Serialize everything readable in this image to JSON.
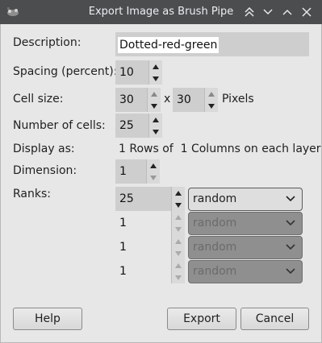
{
  "window": {
    "title": "Export Image as Brush Pipe"
  },
  "titlebar_icons": [
    "app-icon",
    "keep-above-icon",
    "minimize-icon",
    "maximize-icon",
    "close-icon"
  ],
  "fields": {
    "description": {
      "label": "Description:",
      "value": "Dotted-red-green"
    },
    "spacing": {
      "label": "Spacing (percent):",
      "value": "10"
    },
    "cell_size": {
      "label": "Cell size:",
      "width": "30",
      "separator": "x",
      "height": "30",
      "unit": "Pixels"
    },
    "num_cells": {
      "label": "Number of cells:",
      "value": "25"
    },
    "display_as": {
      "label": "Display as:",
      "value": "1 Rows of  1 Columns on each layer"
    },
    "dimension": {
      "label": "Dimension:",
      "value": "1"
    },
    "ranks": {
      "label": "Ranks:",
      "rows": [
        {
          "value": "25",
          "selection": "random",
          "enabled": true
        },
        {
          "value": "1",
          "selection": "random",
          "enabled": false
        },
        {
          "value": "1",
          "selection": "random",
          "enabled": false
        },
        {
          "value": "1",
          "selection": "random",
          "enabled": false
        }
      ]
    }
  },
  "buttons": {
    "help": "Help",
    "export": "Export",
    "cancel": "Cancel"
  }
}
